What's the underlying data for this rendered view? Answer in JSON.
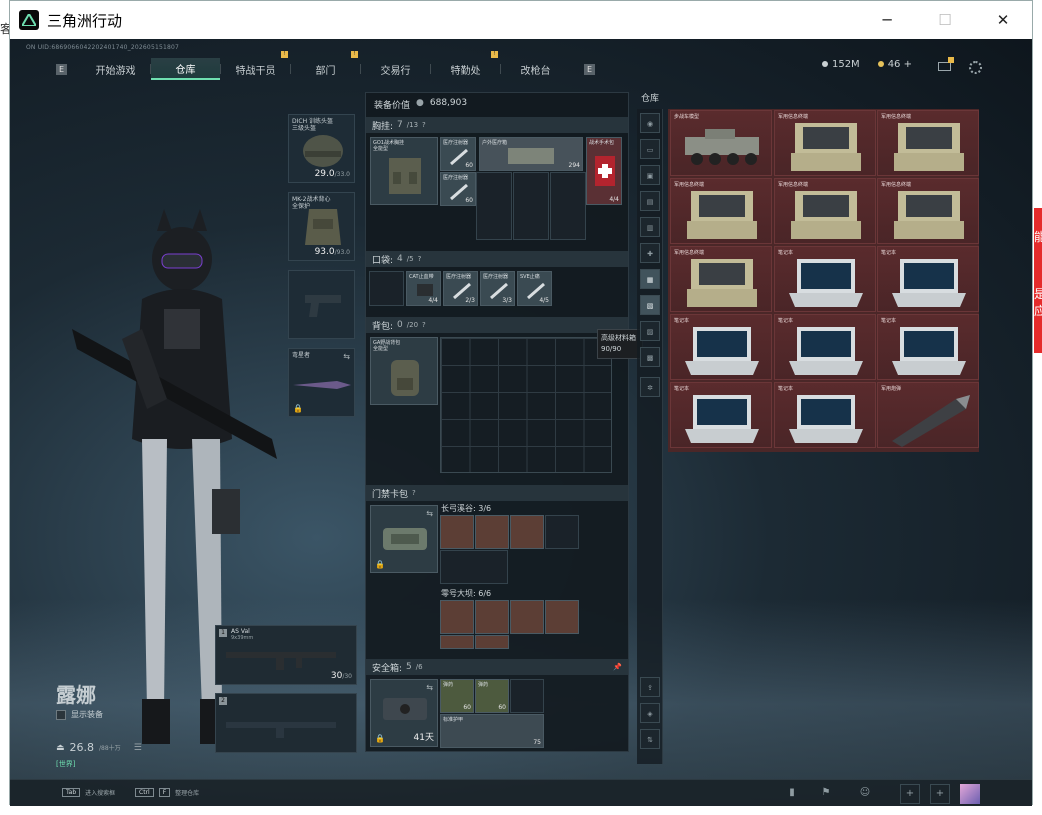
{
  "window": {
    "title": "三角洲行动",
    "buttons": {
      "minimize": "─",
      "maximize": "☐",
      "close": "✕"
    }
  },
  "game": {
    "uid_text": "ON UID:6869066042202401740_202605151807",
    "nav": {
      "prev_key": "E",
      "next_key": "E",
      "tabs": [
        {
          "label": "开始游戏",
          "active": false,
          "badge": false
        },
        {
          "label": "仓库",
          "active": true,
          "badge": false
        },
        {
          "label": "特战干员",
          "active": false,
          "badge": true
        },
        {
          "label": "部门",
          "active": false,
          "badge": true
        },
        {
          "label": "交易行",
          "active": false,
          "badge": false
        },
        {
          "label": "特勤处",
          "active": false,
          "badge": true
        },
        {
          "label": "改枪台",
          "active": false,
          "badge": false
        }
      ]
    },
    "currency": {
      "hafu": "152M",
      "coin": "46",
      "plus": "+"
    },
    "gear_slots": {
      "helmet": {
        "name": "DICH 训练头盔",
        "sub": "三级头盔",
        "value": "29.0",
        "max": "/33.0"
      },
      "armor": {
        "name": "MK-2战术背心",
        "sub": "全保护",
        "value": "93.0",
        "max": "/93.0"
      },
      "melee": {
        "name": "",
        "value": ""
      },
      "knife": {
        "name": "弯星者"
      }
    },
    "weapons": {
      "primary": {
        "num": "1",
        "name": "AS Val",
        "caliber": "9x39mm",
        "ammo": "30",
        "ammo_max": "/30"
      },
      "secondary": {
        "num": "2",
        "name": ""
      }
    },
    "character": {
      "name": "露娜",
      "toggle_label": "显示装备",
      "level": "26.8",
      "level_sub": "/88十万",
      "chat": "[世界]"
    },
    "equipment": {
      "value_label": "装备价值",
      "value": "688,903",
      "chest": {
        "label": "胸挂:",
        "count": "7",
        "max": "/13",
        "help": "?"
      },
      "chest_item": {
        "name": "GO1战术胸挂",
        "sub": "全能型"
      },
      "chest_contents": [
        {
          "name": "医疗注射器",
          "count": "60"
        },
        {
          "name": "医疗注射器",
          "count": "60"
        },
        {
          "name": "户外医疗箱",
          "count": "294"
        },
        {
          "name": "战术手术包",
          "count": "4/4"
        }
      ],
      "pockets": {
        "label": "口袋:",
        "count": "4",
        "max": "/5",
        "help": "?"
      },
      "pocket_items": [
        {
          "name": "CAT止血带",
          "count": "4/4"
        },
        {
          "name": "医疗注射器",
          "count": "2/3"
        },
        {
          "name": "医疗注射器",
          "count": "3/3"
        },
        {
          "name": "SVE止痛",
          "count": "4/5"
        }
      ],
      "backpack": {
        "label": "背包:",
        "count": "0",
        "max": "/20",
        "help": "?"
      },
      "backpack_item": {
        "name": "GA野战背包",
        "sub": "全能型"
      },
      "keycard": {
        "label": "门禁卡包",
        "help": "?"
      },
      "key_zones": [
        {
          "label": "长弓溪谷: 3/6"
        },
        {
          "label": "零号大坝: 6/6"
        }
      ],
      "safebox": {
        "label": "安全箱:",
        "count": "5",
        "max": "/6",
        "pin": "📌",
        "days": "41天"
      },
      "safebox_items": [
        {
          "name": "弹药",
          "count": "60"
        },
        {
          "name": "弹药",
          "count": "60"
        },
        {
          "name": "标准护甲",
          "count": "75"
        }
      ]
    },
    "tooltip": {
      "line1": "高级材料箱",
      "line2": "90/90"
    },
    "warehouse": {
      "title": "仓库",
      "side_tabs": [
        "全部",
        "枪械",
        "装备",
        "配件",
        "弹药",
        "医疗",
        "战术",
        "钥匙",
        "材料",
        "杂物",
        "其他"
      ],
      "items": [
        {
          "name": "步战车模型"
        },
        {
          "name": "军用信息终端"
        },
        {
          "name": "军用信息终端"
        },
        {
          "name": "军用信息终端"
        },
        {
          "name": "军用信息终端"
        },
        {
          "name": "军用信息终端"
        },
        {
          "name": "军用信息终端"
        },
        {
          "name": "笔记本"
        },
        {
          "name": "笔记本"
        },
        {
          "name": "笔记本"
        },
        {
          "name": "笔记本"
        },
        {
          "name": "笔记本"
        },
        {
          "name": "笔记本"
        },
        {
          "name": "笔记本"
        },
        {
          "name": "军用炮弹"
        }
      ]
    },
    "bottom": {
      "key1": "Tab",
      "key1_label": "进入搜索框",
      "key2": "Ctrl",
      "key2b": "F",
      "key2_label": "整理仓库"
    }
  },
  "desktop": {
    "frag1": "客",
    "frag2": "能",
    "frag3": "是",
    "frag4": "应"
  },
  "colors": {
    "accent": "#6fdfb0",
    "warehouse_cell": "#4b2728",
    "badge": "#e9b949",
    "desktop_red": "#e52b2b"
  }
}
